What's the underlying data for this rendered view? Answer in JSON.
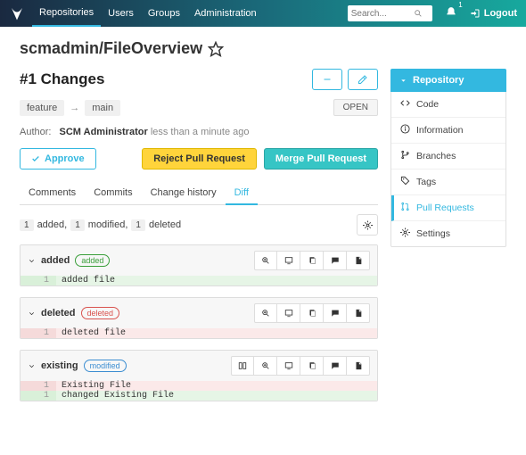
{
  "topbar": {
    "nav": [
      "Repositories",
      "Users",
      "Groups",
      "Administration"
    ],
    "search_placeholder": "Search...",
    "notif_count": "1",
    "logout": "Logout"
  },
  "repo": {
    "title": "scmadmin/FileOverview"
  },
  "pr": {
    "title": "#1 Changes",
    "source_branch": "feature",
    "target_branch": "main",
    "status": "OPEN",
    "author_label": "Author:",
    "author_name": "SCM Administrator",
    "author_time": "less than a minute ago",
    "approve": "Approve",
    "reject": "Reject Pull Request",
    "merge": "Merge Pull Request"
  },
  "tabs": [
    "Comments",
    "Commits",
    "Change history",
    "Diff"
  ],
  "summary": {
    "added_n": "1",
    "added_l": "added,",
    "modified_n": "1",
    "modified_l": "modified,",
    "deleted_n": "1",
    "deleted_l": "deleted"
  },
  "files": [
    {
      "name": "added",
      "tag": "added",
      "lines": [
        {
          "cls": "add",
          "no": "1",
          "txt": "added file"
        }
      ]
    },
    {
      "name": "deleted",
      "tag": "deleted",
      "lines": [
        {
          "cls": "del",
          "no": "1",
          "txt": "deleted file"
        }
      ]
    },
    {
      "name": "existing",
      "tag": "modified",
      "extra_btn": true,
      "lines": [
        {
          "cls": "del",
          "no": "1",
          "txt": "Existing File"
        },
        {
          "cls": "add",
          "no": "1",
          "txt": "changed Existing File"
        }
      ]
    }
  ],
  "sidebar": {
    "header": "Repository",
    "items": [
      {
        "icon": "code",
        "label": "Code"
      },
      {
        "icon": "info",
        "label": "Information"
      },
      {
        "icon": "branch",
        "label": "Branches"
      },
      {
        "icon": "tag",
        "label": "Tags"
      },
      {
        "icon": "pr",
        "label": "Pull Requests",
        "active": true
      },
      {
        "icon": "gear",
        "label": "Settings"
      }
    ]
  }
}
